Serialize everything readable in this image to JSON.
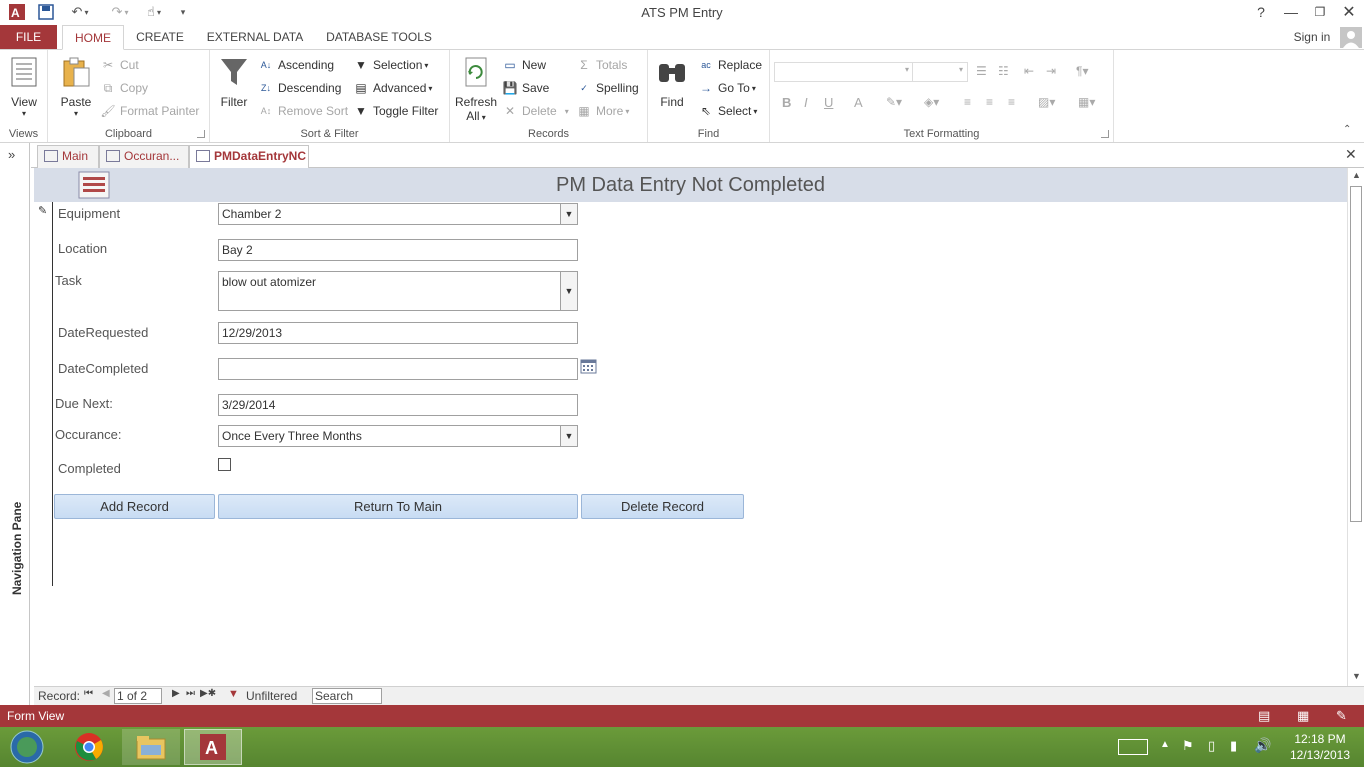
{
  "window": {
    "title": "ATS PM Entry"
  },
  "ribbon_tabs": [
    "FILE",
    "HOME",
    "CREATE",
    "EXTERNAL DATA",
    "DATABASE TOOLS"
  ],
  "sign_in": "Sign in",
  "help": "?",
  "groups": {
    "views": {
      "label": "Views",
      "view": "View"
    },
    "clipboard": {
      "label": "Clipboard",
      "paste": "Paste",
      "cut": "Cut",
      "copy": "Copy",
      "format_painter": "Format Painter"
    },
    "sort_filter": {
      "label": "Sort & Filter",
      "filter": "Filter",
      "ascending": "Ascending",
      "descending": "Descending",
      "remove_sort": "Remove Sort",
      "selection": "Selection",
      "advanced": "Advanced",
      "toggle_filter": "Toggle Filter"
    },
    "records": {
      "label": "Records",
      "refresh": "Refresh",
      "refresh_all": "All",
      "new": "New",
      "save": "Save",
      "delete": "Delete",
      "totals": "Totals",
      "spelling": "Spelling",
      "more": "More"
    },
    "find": {
      "label": "Find",
      "find": "Find",
      "replace": "Replace",
      "goto": "Go To",
      "select": "Select"
    },
    "text_formatting": {
      "label": "Text Formatting",
      "bold": "B",
      "italic": "I",
      "underline": "U",
      "font_color": "A"
    }
  },
  "nav_pane": {
    "label": "Navigation Pane"
  },
  "doc_tabs": [
    {
      "label": "Main"
    },
    {
      "label": "Occuran..."
    },
    {
      "label": "PMDataEntryNC"
    }
  ],
  "form": {
    "title": "PM Data Entry Not Completed",
    "fields": {
      "equipment": {
        "label": "Equipment",
        "value": "Chamber 2"
      },
      "location": {
        "label": "Location",
        "value": "Bay 2"
      },
      "task": {
        "label": "Task",
        "value": "blow out atomizer"
      },
      "date_requested": {
        "label": "DateRequested",
        "value": "12/29/2013"
      },
      "date_completed": {
        "label": "DateCompleted",
        "value": ""
      },
      "due_next": {
        "label": "Due Next:",
        "value": "3/29/2014"
      },
      "occurance": {
        "label": "Occurance:",
        "value": "Once Every Three Months"
      },
      "completed": {
        "label": "Completed",
        "checked": false
      }
    },
    "buttons": {
      "add": "Add Record",
      "return": "Return To Main",
      "delete": "Delete Record"
    }
  },
  "record_nav": {
    "label": "Record:",
    "position": "1 of 2",
    "filter": "Unfiltered",
    "search": "Search"
  },
  "status_bar": {
    "mode": "Form View"
  },
  "clock": {
    "time": "12:18 PM",
    "date": "12/13/2013"
  },
  "colors": {
    "access_red": "#a4373a",
    "header_blue": "#d7dde8",
    "taskbar_green": "#5e8c34"
  }
}
